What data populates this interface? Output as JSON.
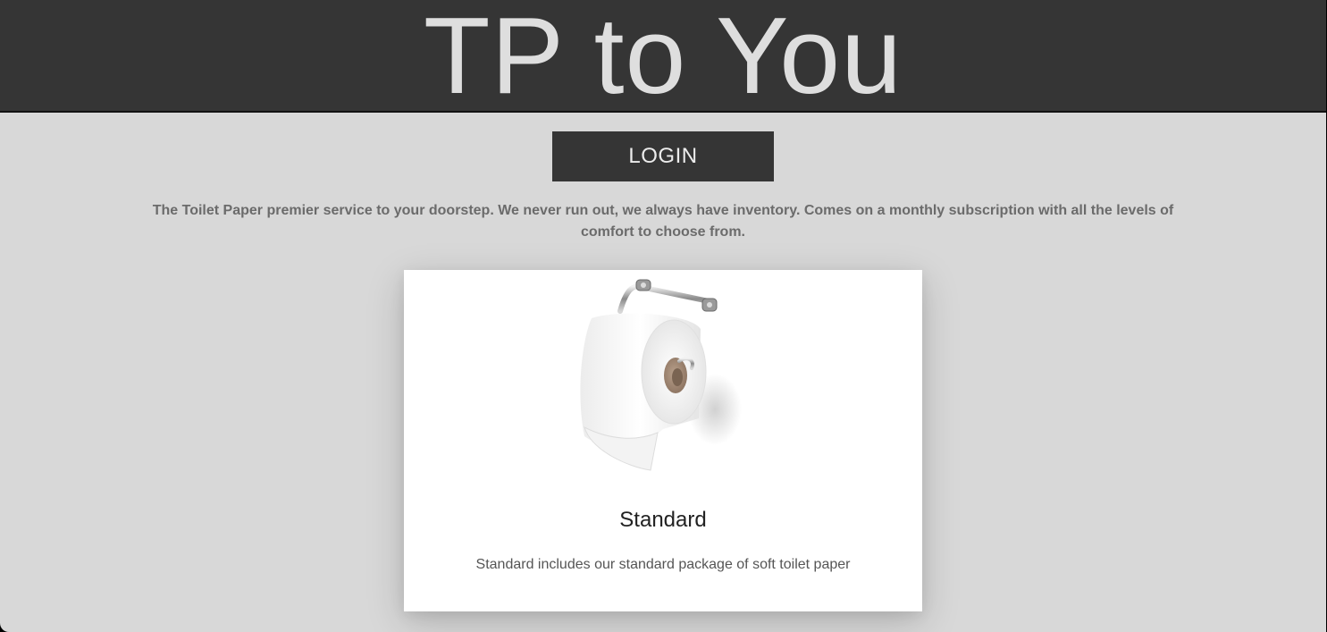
{
  "header": {
    "title": "TP to You"
  },
  "actions": {
    "login_label": "LOGIN"
  },
  "intro": {
    "tagline": "The Toilet Paper premier service to your doorstep. We never run out, we always have inventory. Comes on a monthly subscription with all the levels of comfort to choose from."
  },
  "products": [
    {
      "name": "Standard",
      "description": "Standard includes our standard package of soft toilet paper",
      "image_icon": "toilet-paper-roll-icon"
    }
  ],
  "colors": {
    "header_bg": "#353535",
    "page_bg": "#d8d8d8",
    "title_text": "#dedede",
    "button_bg": "#353535",
    "card_bg": "#ffffff"
  }
}
